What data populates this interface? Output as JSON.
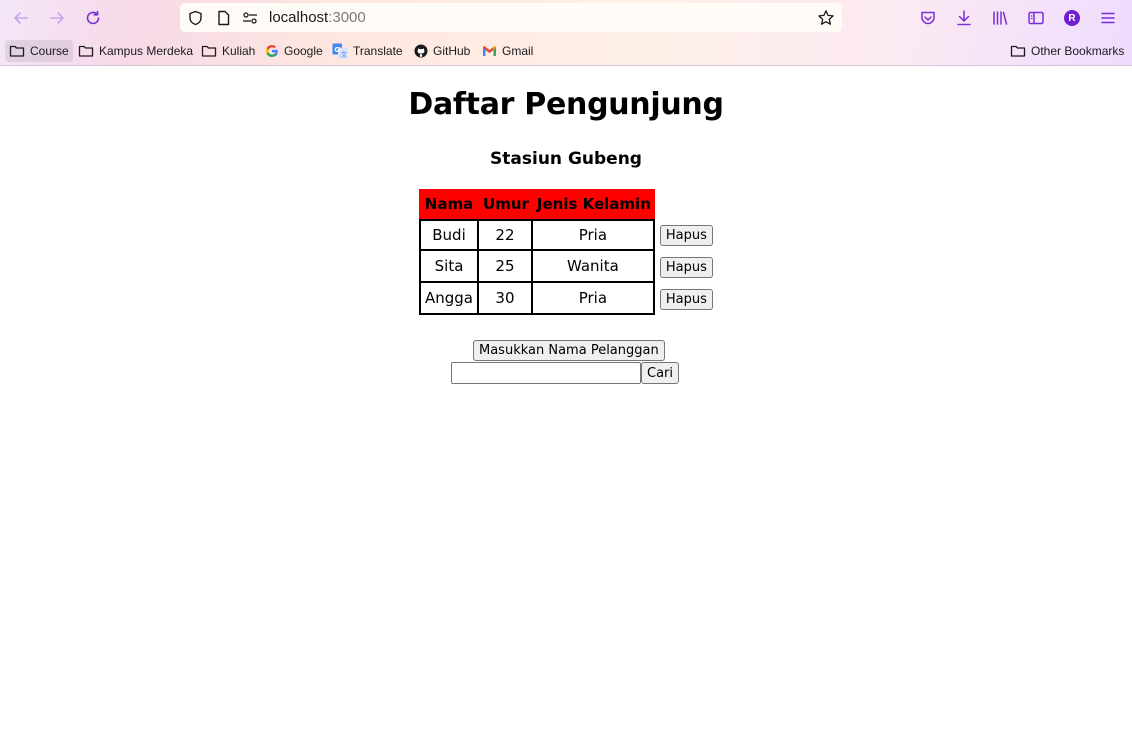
{
  "browser": {
    "url_host": "localhost",
    "url_port": ":3000",
    "bookmarks": [
      {
        "label": "Course",
        "icon": "folder-icon"
      },
      {
        "label": "Kampus Merdeka",
        "icon": "folder-icon"
      },
      {
        "label": "Kuliah",
        "icon": "folder-icon"
      },
      {
        "label": "Google",
        "icon": "google-icon"
      },
      {
        "label": "Translate",
        "icon": "translate-icon"
      },
      {
        "label": "GitHub",
        "icon": "github-icon"
      },
      {
        "label": "Gmail",
        "icon": "gmail-icon"
      }
    ],
    "other_bookmarks": "Other Bookmarks",
    "avatar_initial": "R"
  },
  "page": {
    "title": "Daftar Pengunjung",
    "subtitle": "Stasiun Gubeng",
    "table": {
      "headers": [
        "Nama",
        "Umur",
        "Jenis Kelamin"
      ],
      "rows": [
        {
          "nama": "Budi",
          "umur": "22",
          "jenis_kelamin": "Pria",
          "action": "Hapus"
        },
        {
          "nama": "Sita",
          "umur": "25",
          "jenis_kelamin": "Wanita",
          "action": "Hapus"
        },
        {
          "nama": "Angga",
          "umur": "30",
          "jenis_kelamin": "Pria",
          "action": "Hapus"
        }
      ]
    },
    "add_button": "Masukkan Nama Pelanggan",
    "search_input_value": "",
    "search_button": "Cari"
  },
  "colors": {
    "table_header_bg": "#ff0000",
    "avatar_bg": "#6f1fd1",
    "toolbar_accent": "#7a2fd6"
  }
}
